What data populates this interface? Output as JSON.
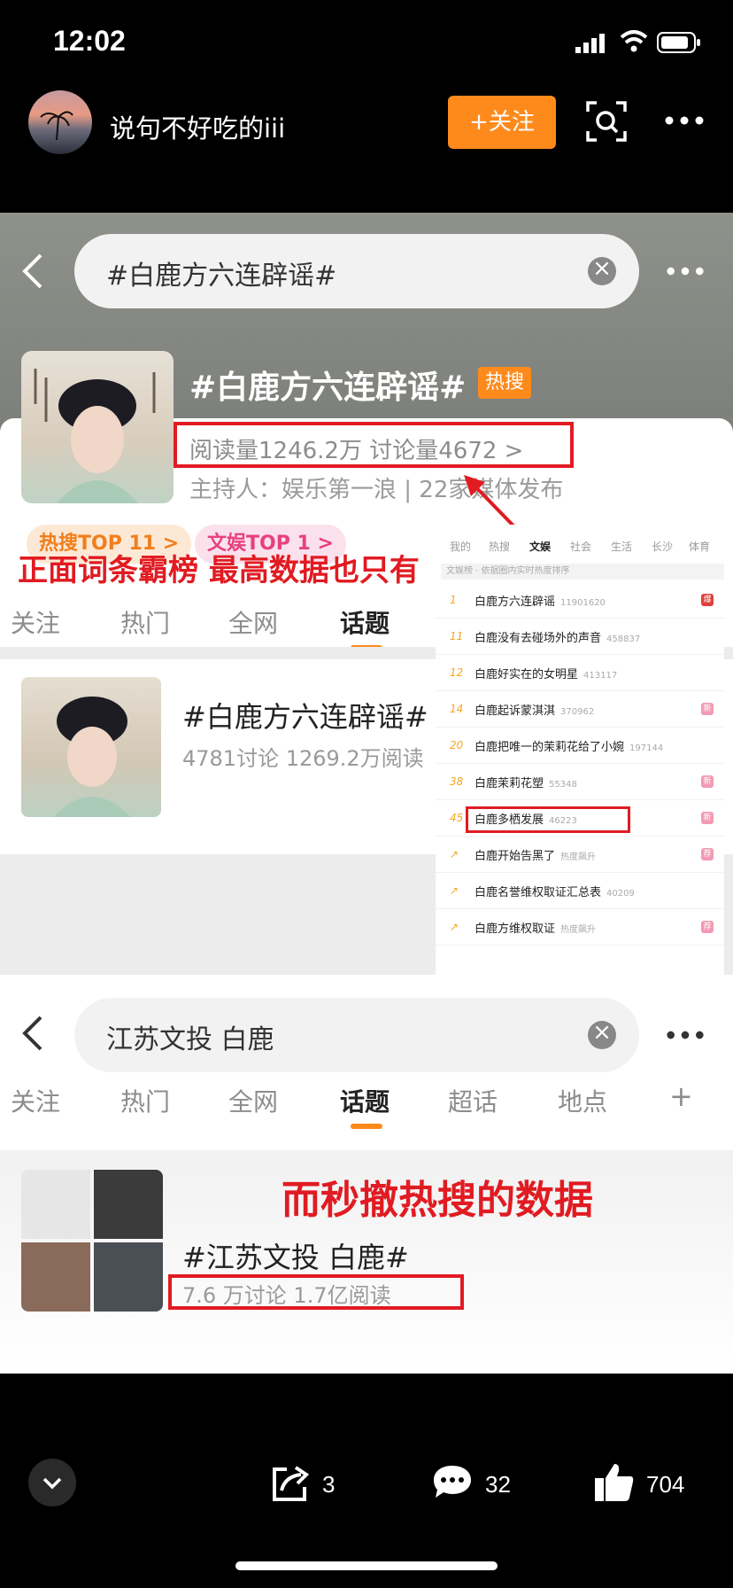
{
  "status": {
    "time": "12:02"
  },
  "author": {
    "name": "说句不好吃的iii",
    "follow_label": "+关注"
  },
  "shot1": {
    "query": "#白鹿方六连辟谣#",
    "topic_title": "#白鹿方六连辟谣#",
    "hot_tag": "热搜",
    "read_stats": "阅读量1246.2万  讨论量4672  >",
    "host": "主持人：娱乐第一浪 | 22家媒体发布",
    "pill_a": "热搜TOP 11 >",
    "pill_b": "文娱TOP 1 >",
    "caption": "正面词条霸榜 最高数据也只有",
    "tabs": [
      "关注",
      "热门",
      "全网",
      "话题"
    ],
    "result_title": "#白鹿方六连辟谣#",
    "result_sub": "4781讨论 1269.2万阅读"
  },
  "rank_list": {
    "tabs": [
      "我的",
      "热搜",
      "文娱",
      "社会",
      "生活",
      "长沙",
      "体育"
    ],
    "note": "文娱榜 · 依据圈内实时热度排序",
    "rows": [
      {
        "n": "1",
        "t": "白鹿方六连辟谣",
        "v": "11901620",
        "badge": "爆"
      },
      {
        "n": "11",
        "t": "白鹿没有去碰场外的声音",
        "v": "458837",
        "badge": ""
      },
      {
        "n": "12",
        "t": "白鹿好实在的女明星",
        "v": "413117",
        "badge": ""
      },
      {
        "n": "14",
        "t": "白鹿起诉蒙淇淇",
        "v": "370962",
        "badge": "新"
      },
      {
        "n": "20",
        "t": "白鹿把唯一的茉莉花给了小婉",
        "v": "197144",
        "badge": ""
      },
      {
        "n": "38",
        "t": "白鹿茉莉花塑",
        "v": "55348",
        "badge": "新"
      },
      {
        "n": "45",
        "t": "白鹿多栖发展",
        "v": "46223",
        "badge": "新"
      },
      {
        "n": "↗",
        "t": "白鹿开始告黑了",
        "v": "热度飙升",
        "badge": "荐"
      },
      {
        "n": "↗",
        "t": "白鹿名誉维权取证汇总表",
        "v": "40209",
        "badge": ""
      },
      {
        "n": "↗",
        "t": "白鹿方维权取证",
        "v": "热度飙升",
        "badge": "荐"
      }
    ]
  },
  "shot2": {
    "query": "江苏文投 白鹿",
    "tabs": [
      "关注",
      "热门",
      "全网",
      "话题",
      "超话",
      "地点",
      "+"
    ],
    "caption": "而秒撤热搜的数据",
    "result_title": "#江苏文投 白鹿#",
    "result_sub": "7.6 万讨论 1.7亿阅读"
  },
  "actions": {
    "share": "3",
    "comment": "32",
    "like": "704"
  }
}
